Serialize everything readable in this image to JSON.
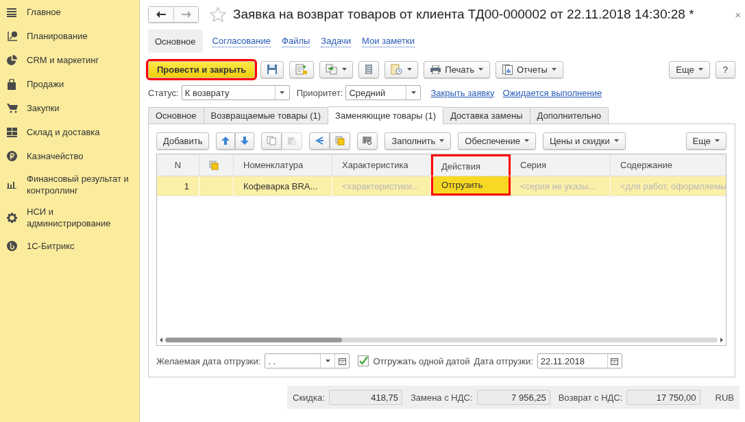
{
  "sidebar": {
    "items": [
      {
        "label": "Главное"
      },
      {
        "label": "Планирование"
      },
      {
        "label": "CRM и маркетинг"
      },
      {
        "label": "Продажи"
      },
      {
        "label": "Закупки"
      },
      {
        "label": "Склад и доставка"
      },
      {
        "label": "Казначейство"
      },
      {
        "label": "Финансовый результат и контроллинг"
      },
      {
        "label": "НСИ и администрирование"
      },
      {
        "label": "1С-Битрикс"
      }
    ]
  },
  "window": {
    "title": "Заявка на возврат товаров от клиента ТД00-000002 от 22.11.2018 14:30:28 *",
    "close": "×"
  },
  "nav_tabs": [
    {
      "label": "Основное",
      "selected": true
    },
    {
      "label": "Согласование",
      "selected": false
    },
    {
      "label": "Файлы",
      "selected": false
    },
    {
      "label": "Задачи",
      "selected": false
    },
    {
      "label": "Мои заметки",
      "selected": false
    }
  ],
  "toolbar": {
    "post_button": {
      "label": "Провести и закрыть",
      "highlighted": true
    },
    "print": "Печать",
    "reports": "Отчеты",
    "more": "Еще",
    "help": "?"
  },
  "status": {
    "label": "Статус:",
    "value": "К возврату"
  },
  "priority": {
    "label": "Приоритет:",
    "value": "Средний"
  },
  "links": [
    "Закрыть заявку",
    "Ожидается выполнение"
  ],
  "tabs": [
    {
      "label": "Основное",
      "selected": false
    },
    {
      "label": "Возвращаемые товары (1)",
      "selected": false
    },
    {
      "label": "Заменяющие товары (1)",
      "selected": true
    },
    {
      "label": "Доставка замены",
      "selected": false
    },
    {
      "label": "Дополнительно",
      "selected": false
    }
  ],
  "table_toolbar": {
    "add": "Добавить",
    "menus": [
      "Заполнить",
      "Обеспечение",
      "Цены и скидки"
    ],
    "more": "Еще"
  },
  "table": {
    "columns": [
      {
        "kind": "text",
        "label": "N",
        "highlighted": false
      },
      {
        "kind": "icon",
        "highlighted": false
      },
      {
        "kind": "text",
        "label": "Номенклатура",
        "highlighted": false
      },
      {
        "kind": "text",
        "label": "Характеристика",
        "highlighted": false
      },
      {
        "kind": "text",
        "label": "Действия",
        "highlighted": true
      },
      {
        "kind": "text",
        "label": "Серия",
        "highlighted": false
      },
      {
        "kind": "text",
        "label": "Содержание",
        "highlighted": false
      }
    ],
    "rows": [
      {
        "selected": true,
        "cells": [
          {
            "kind": "number",
            "text": "1"
          },
          {
            "kind": "empty"
          },
          {
            "kind": "value",
            "text": "Кофеварка BRA..."
          },
          {
            "kind": "placeholder",
            "text": "<характеристики..."
          },
          {
            "kind": "value",
            "text": "Отгрузить"
          },
          {
            "kind": "placeholder",
            "text": "<серия не указы..."
          },
          {
            "kind": "placeholder",
            "text": "<для работ, оформляемы"
          }
        ]
      }
    ]
  },
  "bottom": {
    "desired_date": {
      "label": "Желаемая дата отгрузки:",
      "value": ".  ."
    },
    "one_date": {
      "label": "Отгружать одной датой",
      "checked": true
    },
    "ship_date": {
      "label": "Дата отгрузки:",
      "value": "22.11.2018"
    }
  },
  "totals": [
    {
      "label": "Скидка:",
      "value": "418,75"
    },
    {
      "label": "Замена с НДС:",
      "value": "7 956,25"
    },
    {
      "label": "Возврат с НДС:",
      "value": "17 750,00"
    }
  ],
  "currency": "RUB"
}
